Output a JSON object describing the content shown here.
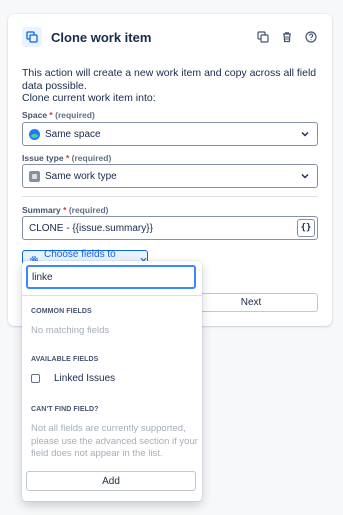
{
  "header": {
    "title": "Clone work item"
  },
  "description": {
    "line1": "This action will create a new work item and copy across all field data possible.",
    "line2": "Clone current work item into:"
  },
  "space": {
    "label": "Space",
    "required_mark": "*",
    "required_text": "(required)",
    "value": "Same space"
  },
  "issue_type": {
    "label": "Issue type",
    "required_mark": "*",
    "required_text": "(required)",
    "value": "Same work type"
  },
  "summary": {
    "label": "Summary",
    "required_mark": "*",
    "required_text": "(required)",
    "value": "CLONE - {{issue.summary}}",
    "smart_value_button": "{}"
  },
  "choose_fields": {
    "label": "Choose fields to set..."
  },
  "next_button": "Next",
  "dropdown": {
    "search_value": "linke",
    "common_heading": "COMMON FIELDS",
    "common_empty": "No matching fields",
    "available_heading": "AVAILABLE FIELDS",
    "available_items": [
      "Linked Issues"
    ],
    "cant_find_heading": "CAN'T FIND FIELD?",
    "cant_find_text": "Not all fields are currently supported, please use the advanced section if your field does not appear in the list.",
    "add_button": "Add"
  },
  "colors": {
    "accent": "#0c66e4",
    "required": "#c9372c"
  }
}
